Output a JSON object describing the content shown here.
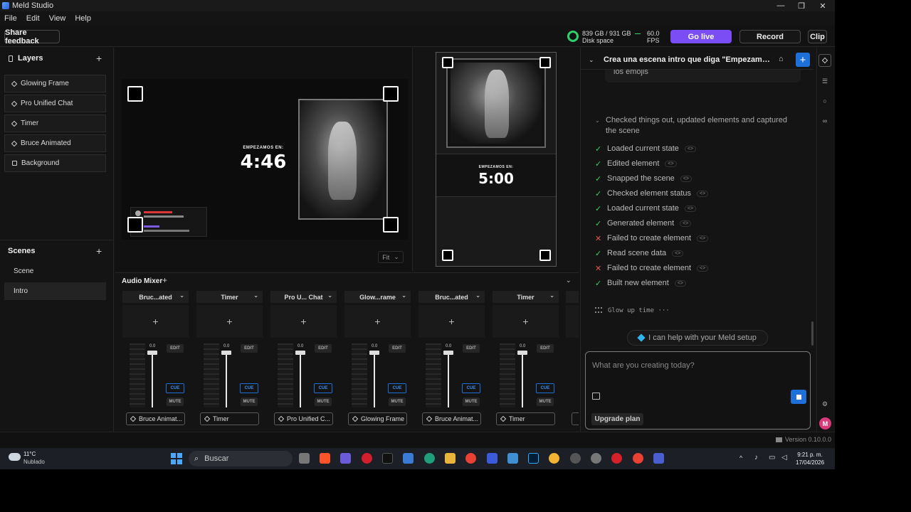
{
  "window": {
    "title": "Meld Studio",
    "min_label": "—",
    "max_label": "❐",
    "close_label": "✕"
  },
  "menu": [
    "File",
    "Edit",
    "View",
    "Help"
  ],
  "toolbar": {
    "share_feedback": "Share feedback",
    "disk_value": "839 GB / 931 GB",
    "disk_label": "Disk space",
    "fps_value": "60.0",
    "fps_label": "FPS",
    "go_live": "Go live",
    "record": "Record",
    "clip": "Clip"
  },
  "layers": {
    "title": "Layers",
    "items": [
      {
        "label": "Glowing Frame",
        "icon": "diamond-icon"
      },
      {
        "label": "Pro Unified Chat",
        "icon": "diamond-icon"
      },
      {
        "label": "Timer",
        "icon": "diamond-icon"
      },
      {
        "label": "Bruce Animated",
        "icon": "diamond-icon"
      },
      {
        "label": "Background",
        "icon": "square-icon"
      }
    ]
  },
  "scenes": {
    "title": "Scenes",
    "items": [
      {
        "label": "Scene"
      },
      {
        "label": "Intro",
        "active": true
      }
    ]
  },
  "preview": {
    "landscape_label": "EMPEZAMOS EN:",
    "landscape_time": "4:46",
    "vertical_label": "EMPEZAMOS EN:",
    "vertical_time": "5:00",
    "fit": "Fit"
  },
  "mixer": {
    "title": "Audio Mixer",
    "channels": [
      {
        "name": "Bruc...ated",
        "db": "0.0",
        "source": "Bruce Animat..."
      },
      {
        "name": "Timer",
        "db": "0.0",
        "source": "Timer"
      },
      {
        "name": "Pro U... Chat",
        "db": "0.0",
        "source": "Pro Unified C..."
      },
      {
        "name": "Glow...rame",
        "db": "0.0",
        "source": "Glowing Frame"
      },
      {
        "name": "Bruc...ated",
        "db": "0.0",
        "source": "Bruce Animat..."
      },
      {
        "name": "Timer",
        "db": "0.0",
        "source": "Timer"
      }
    ],
    "edit_label": "EDIT",
    "cue_label": "CUE",
    "mute_label": "MUTE"
  },
  "chat": {
    "title": "Crea una escena intro que diga \"Empezamos en:...",
    "prev_message_tail": "los emojis",
    "summary": "Checked things out, updated elements and captured the scene",
    "steps": [
      {
        "label": "Loaded current state",
        "status": "ok"
      },
      {
        "label": "Edited element",
        "status": "ok"
      },
      {
        "label": "Snapped the scene",
        "status": "ok"
      },
      {
        "label": "Checked element status",
        "status": "ok"
      },
      {
        "label": "Loaded current state",
        "status": "ok"
      },
      {
        "label": "Generated element",
        "status": "ok"
      },
      {
        "label": "Failed to create element",
        "status": "fail"
      },
      {
        "label": "Read scene data",
        "status": "ok"
      },
      {
        "label": "Failed to create element",
        "status": "fail"
      },
      {
        "label": "Built new element",
        "status": "ok"
      }
    ],
    "thinking": "Glow up time ···",
    "helper": "I can help with your Meld setup",
    "placeholder": "What are you creating today?",
    "upgrade": "Upgrade plan"
  },
  "footer": {
    "version": "Version 0.10.0.0"
  },
  "taskbar": {
    "weather_temp": "11°C",
    "weather_desc": "Nublado",
    "search": "Buscar",
    "time": "9:21 p. m.",
    "date": "17/04/2026"
  },
  "colors": {
    "accent": "#7b4df5",
    "blue": "#1f6fd8",
    "ok": "#3ecf5e",
    "fail": "#e05555"
  }
}
